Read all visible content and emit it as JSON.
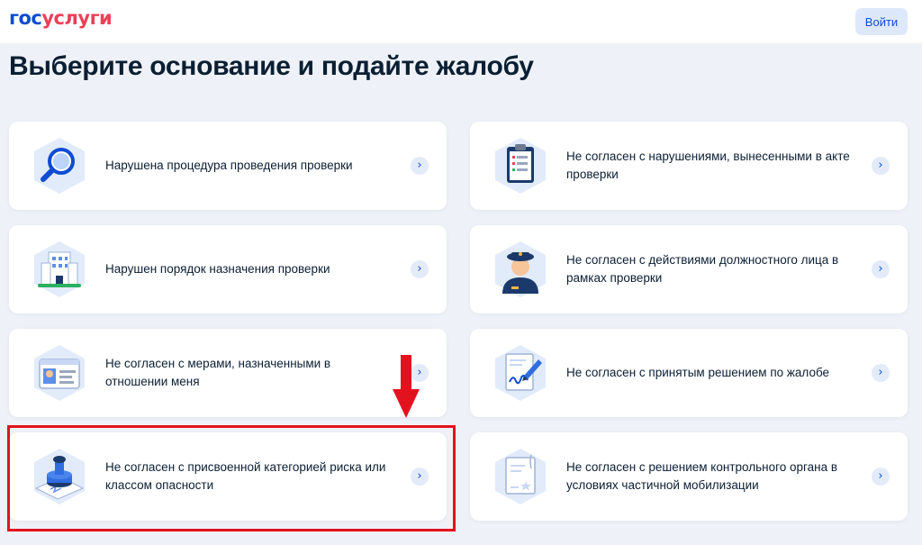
{
  "header": {
    "logo_part1": "гос",
    "logo_part2": "услуги",
    "login_label": "Войти"
  },
  "page_title": "Выберите основание и подайте жалобу",
  "cards": [
    {
      "label": "Нарушена процедура проведения проверки",
      "icon": "magnifier-icon"
    },
    {
      "label": "Не согласен с нарушениями, вынесенными в акте проверки",
      "icon": "clipboard-icon"
    },
    {
      "label": "Нарушен порядок назначения проверки",
      "icon": "building-icon"
    },
    {
      "label": "Не согласен с действиями должностного лица в рамках проверки",
      "icon": "officer-icon"
    },
    {
      "label": "Не согласен с мерами, назначенными в отношении меня",
      "icon": "id-card-icon"
    },
    {
      "label": "Не согласен с принятым решением по жалобе",
      "icon": "signed-document-icon"
    },
    {
      "label": "Не согласен с присвоенной категорией риска или классом опасности",
      "icon": "stamp-icon"
    },
    {
      "label": "Не согласен с решением контрольного органа в условиях частичной мобилизации",
      "icon": "certificate-icon"
    }
  ],
  "colors": {
    "brand_blue": "#0d4cd3",
    "brand_red": "#ee3f58",
    "background": "#eef2f8",
    "highlight_red": "#e3121f"
  },
  "icons": {
    "chevron": "chevron-right-icon",
    "annotation": "red-down-arrow"
  }
}
